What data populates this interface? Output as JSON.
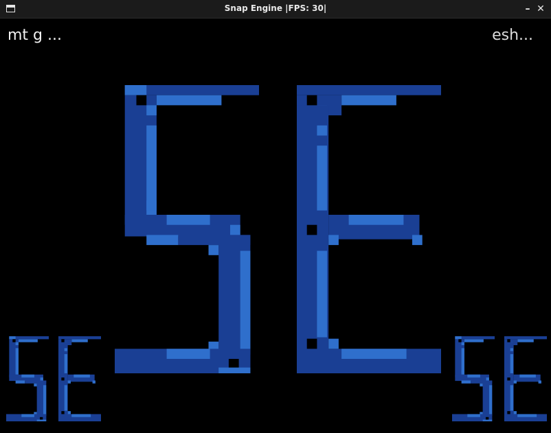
{
  "window": {
    "title": "Snap Engine |FPS: 30|",
    "minimize_icon": "minimize-icon",
    "close_icon": "close-icon",
    "minimize_glyph": "–",
    "close_glyph": "✕"
  },
  "hud": {
    "left_text": "mt g ...",
    "right_text": "esh..."
  },
  "logo": {
    "name": "SE",
    "colors": {
      "dark": "#1a3f94",
      "light": "#2f6fcc",
      "hole": "#000000"
    }
  }
}
